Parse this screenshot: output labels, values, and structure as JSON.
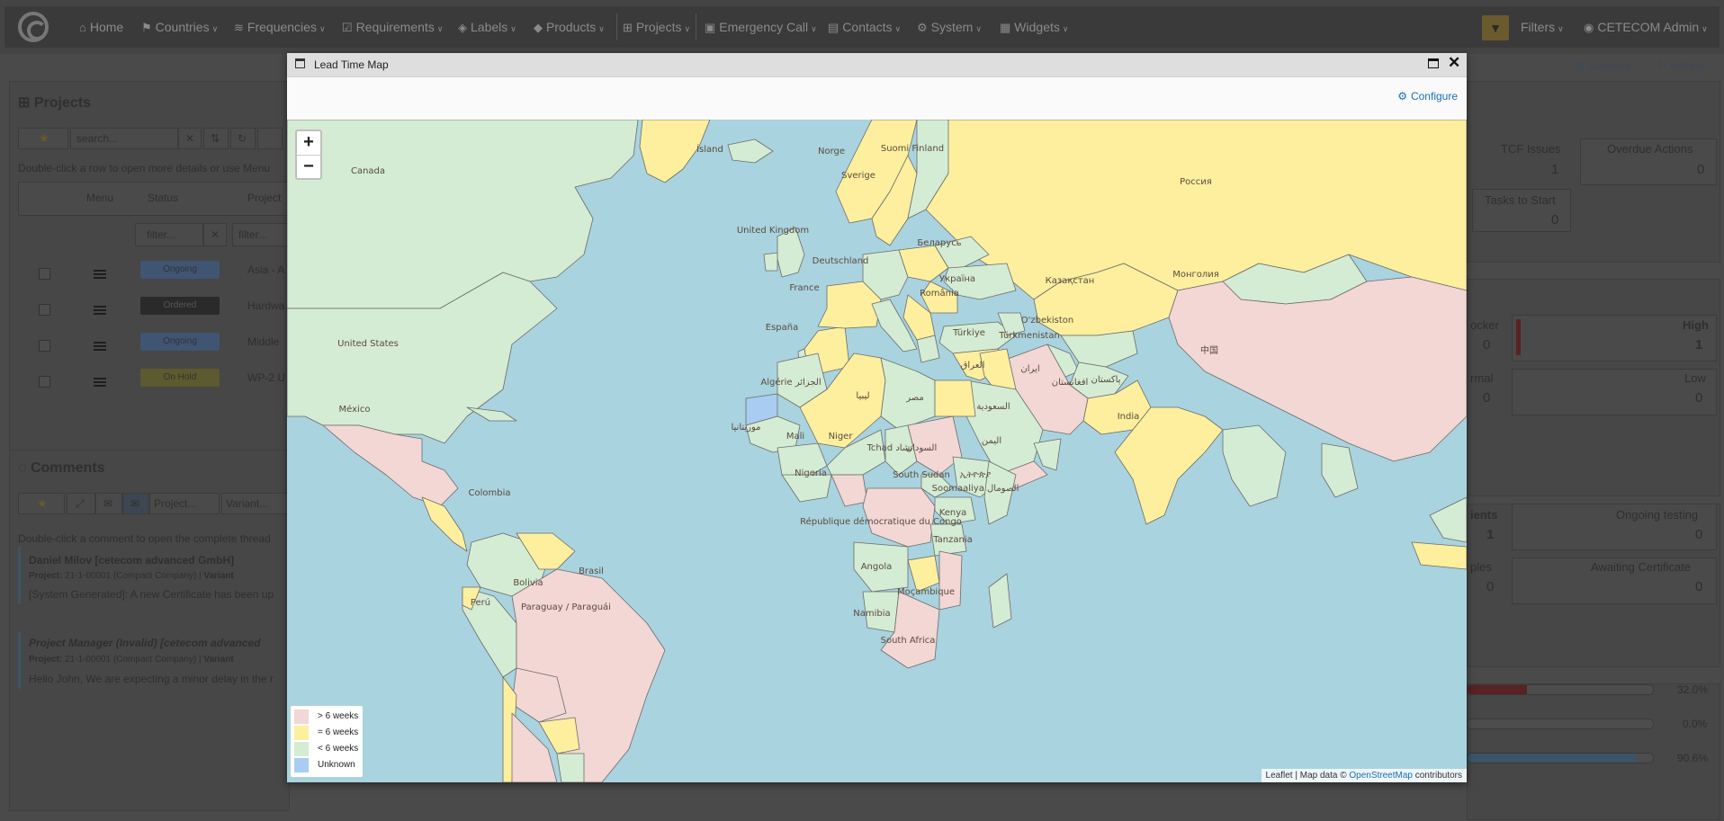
{
  "navbar": {
    "home": "Home",
    "countries": "Countries",
    "frequencies": "Frequencies",
    "requirements": "Requirements",
    "labels": "Labels",
    "products": "Products",
    "projects": "Projects",
    "emergency_call": "Emergency Call",
    "contacts": "Contacts",
    "system": "System",
    "widgets": "Widgets",
    "filters": "Filters",
    "user": "CETECOM Admin"
  },
  "page": {
    "statistics": "Statistics",
    "refresh": "Refresh",
    "projects_title": "Projects",
    "search_placeholder": "search...",
    "hint": "Double-click a row to open more details or use Menu",
    "col_menu": "Menu",
    "col_status": "Status",
    "col_project": "Project",
    "filter_btn": "filter...",
    "filter_placeholder": "filter...",
    "rows": [
      {
        "status": "Ongoing",
        "project": "Asia - A"
      },
      {
        "status": "Ordered",
        "project": "Hardwa"
      },
      {
        "status": "Ongoing",
        "project": "Middle"
      },
      {
        "status": "On Hold",
        "project": "WP-2 U"
      }
    ],
    "comments_title": "Comments",
    "comments_project_btn": "Project...",
    "comments_variant_btn": "Variant...",
    "comments_hint": "Double-click a comment to open the complete thread",
    "comments": [
      {
        "author": "Daniel Milov [cetecom advanced GmbH]",
        "project_label": "Project:",
        "project": "21-1-00001 (Compact Company)",
        "variant_label": "Variant",
        "text": "[System Generated]: A new Certificate has been up"
      },
      {
        "author": "Project Manager (Invalid) [cetecom advanced",
        "project_label": "Project:",
        "project": "21-1-00001 (Compact Company)",
        "variant_label": "Variant",
        "text": "Hello John, We are expecting a minor delay in the r"
      }
    ],
    "kpis": [
      {
        "label": "TCF Issues",
        "value": "1"
      },
      {
        "label": "Overdue Actions",
        "value": "0"
      },
      {
        "label": "Tasks to Start",
        "value": "0"
      },
      {
        "label": "High",
        "value": "1"
      },
      {
        "label": "Low",
        "value": "0"
      },
      {
        "label": "Ongoing testing",
        "value": "0"
      },
      {
        "label": "Awaiting Certificate",
        "value": "0"
      }
    ],
    "kpi_partials": [
      "ocker",
      "rmal",
      "ients",
      "ples"
    ],
    "kpi_partial_values": [
      "0",
      "0",
      "1",
      "0"
    ],
    "progress": [
      {
        "label": "32.0%",
        "value": 0.32,
        "color": "#5a2222"
      },
      {
        "label": "0.0%",
        "value": 0.0,
        "color": "#4d4d4d"
      },
      {
        "label": "90.6%",
        "value": 0.906,
        "color": "#3c5468"
      }
    ]
  },
  "modal": {
    "title": "Lead Time Map",
    "configure": "Configure",
    "zoom_in": "+",
    "zoom_out": "−",
    "legend": [
      {
        "label": "> 6 weeks",
        "color": "#f2d7d5"
      },
      {
        "label": "= 6 weeks",
        "color": "#fdef9e"
      },
      {
        "label": "< 6 weeks",
        "color": "#d4ecd3"
      },
      {
        "label": "Unknown",
        "color": "#a8cdf0"
      }
    ],
    "attribution": {
      "leaflet": "Leaflet",
      "sep": " | Map data © ",
      "osm": "OpenStreetMap",
      "suffix": " contributors"
    },
    "countries": [
      "Canada",
      "Ísland",
      "Suomi Finland",
      "Norge",
      "Sverige",
      "Россия",
      "United Kingdom",
      "Deutschland",
      "Беларусь",
      "France",
      "România",
      "Україна",
      "Казақстан",
      "España",
      "Türkiye",
      "Монголия",
      "United States",
      "Algérie الجزائر",
      "ليبيا",
      "مصر",
      "السعودية",
      "العراق",
      "ایران",
      "Türkmenistan",
      "افغانستان",
      "پاکستان",
      "中国",
      "India",
      "México",
      "Mali",
      "Niger",
      "Tchad تشاد",
      "السودان",
      "Nigeria",
      "South Sudan",
      "ኢትዮጵያ",
      "Soomaaliya الصومال",
      "Kenya",
      "République démocratique du Congo",
      "Tanzania",
      "Colombia",
      "Brasil",
      "Perú",
      "Bolivia",
      "Paraguay / Paraguái",
      "Angola",
      "Namibia",
      "Moçambique",
      "South Africa",
      "موريتانيا",
      "اليمن",
      "O'zbekiston"
    ]
  }
}
